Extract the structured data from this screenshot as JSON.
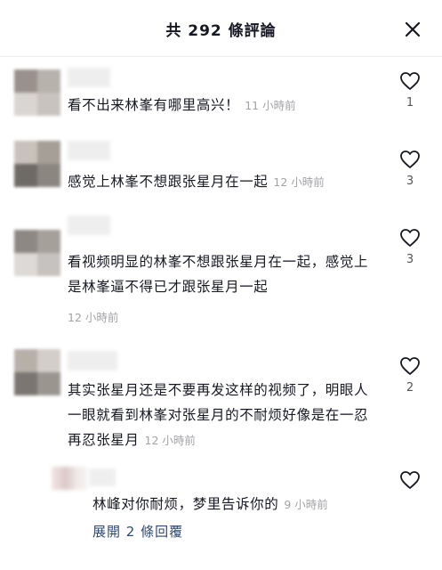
{
  "header": {
    "title": "共 292 條評論"
  },
  "comments": [
    {
      "text": "看不出来林峯有哪里高兴！",
      "time": "11 小時前",
      "likes": "1"
    },
    {
      "text": "感觉上林峯不想跟张星月在一起",
      "time": "12 小時前",
      "likes": "3"
    },
    {
      "text": "看视频明显的林峯不想跟张星月在一起，感觉上是林峯逼不得已才跟张星月一起",
      "time": "12 小時前",
      "likes": "3"
    },
    {
      "text": "其实张星月还是不要再发这样的视频了，明眼人一眼就看到林峯对张星月的不耐烦好像是在一忍再忍张星月",
      "time": "12 小時前",
      "likes": "2"
    }
  ],
  "reply": {
    "text": "林峰对你耐烦，梦里告诉你的",
    "time": "9 小時前",
    "expand_label": "展開 2 條回覆"
  },
  "icons": {
    "close": "close-icon",
    "like": "heart-outline-icon"
  },
  "colors": {
    "link": "#2d4a72",
    "timestamp": "#a3a3a8",
    "text": "#161823"
  }
}
